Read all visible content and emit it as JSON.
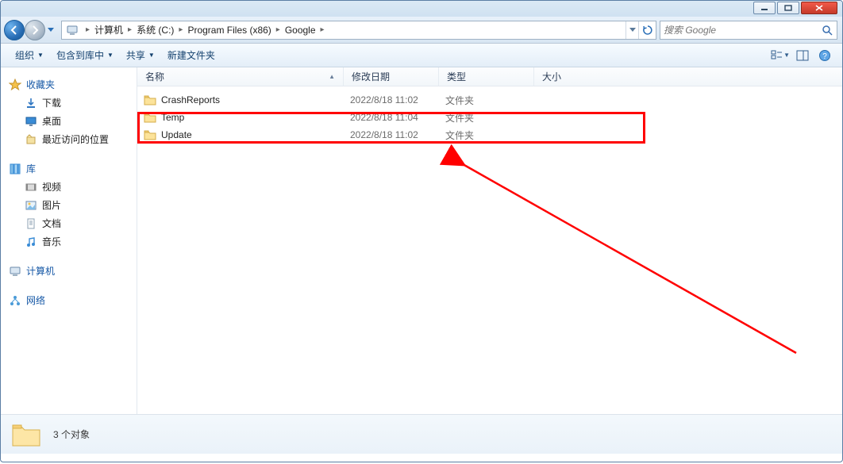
{
  "breadcrumb": {
    "root": "计算机",
    "p1": "系统 (C:)",
    "p2": "Program Files (x86)",
    "p3": "Google"
  },
  "search": {
    "placeholder": "搜索 Google"
  },
  "toolbar": {
    "organize": "组织",
    "include": "包含到库中",
    "share": "共享",
    "newfolder": "新建文件夹"
  },
  "sidebar": {
    "fav": {
      "head": "收藏夹",
      "downloads": "下载",
      "desktop": "桌面",
      "recent": "最近访问的位置"
    },
    "lib": {
      "head": "库",
      "video": "视频",
      "pic": "图片",
      "doc": "文档",
      "music": "音乐"
    },
    "computer": "计算机",
    "network": "网络"
  },
  "columns": {
    "name": "名称",
    "date": "修改日期",
    "type": "类型",
    "size": "大小"
  },
  "rows": [
    {
      "name": "CrashReports",
      "date": "2022/8/18 11:02",
      "type": "文件夹"
    },
    {
      "name": "Temp",
      "date": "2022/8/18 11:04",
      "type": "文件夹"
    },
    {
      "name": "Update",
      "date": "2022/8/18 11:02",
      "type": "文件夹"
    }
  ],
  "status": {
    "count": "3 个对象"
  }
}
